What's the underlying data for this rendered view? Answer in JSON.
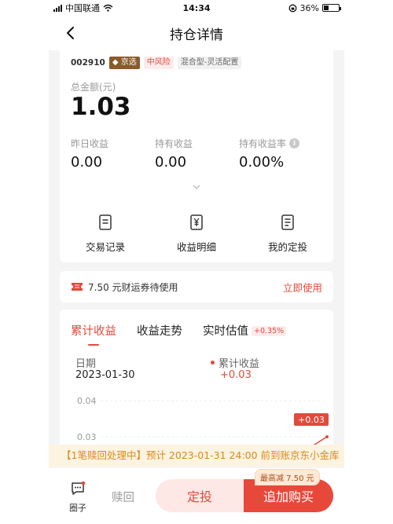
{
  "status_bar": {
    "carrier": "中国联通",
    "time": "14:34",
    "battery": "36%",
    "battery_level": 0.36
  },
  "nav": {
    "title": "持仓详情"
  },
  "fund": {
    "code": "002910",
    "tag_jx": "京选",
    "risk": "中风险",
    "type": "混合型-灵活配置"
  },
  "holding": {
    "total_label": "总金额(元)",
    "total_value": "1.03",
    "stats": [
      {
        "label": "昨日收益",
        "value": "0.00"
      },
      {
        "label": "持有收益",
        "value": "0.00"
      },
      {
        "label": "持有收益率",
        "value": "0.00%"
      }
    ]
  },
  "actions": [
    {
      "label": "交易记录",
      "icon": "record-icon"
    },
    {
      "label": "收益明细",
      "icon": "yen-receipt-icon"
    },
    {
      "label": "我的定投",
      "icon": "document-icon"
    }
  ],
  "coupon": {
    "text": "7.50 元财运券待使用",
    "link": "立即使用"
  },
  "chart_tabs": [
    {
      "label": "累计收益",
      "active": true
    },
    {
      "label": "收益走势",
      "active": false
    },
    {
      "label": "实时估值",
      "active": false,
      "badge": "+0.35%"
    }
  ],
  "chart_info": {
    "date_label": "日期",
    "date_value": "2023-01-30",
    "earn_label": "累计收益",
    "earn_value": "+0.03"
  },
  "chart_data": {
    "type": "line",
    "title": "",
    "xlabel": "",
    "ylabel": "",
    "y_ticks": [
      "0.04",
      "0.03"
    ],
    "ylim": [
      0.02,
      0.04
    ],
    "point_label": "+0.03",
    "series": [
      {
        "values": [
          0.027,
          0.03
        ]
      }
    ]
  },
  "notice": "【1笔赎回处理中】预计 2023-01-31 24:00 前到账京东小金库",
  "bottom_bar": {
    "circle_label": "圈子",
    "redeem_label": "赎回",
    "fixed_label": "定投",
    "buy_label": "追加购买",
    "buy_badge": "最高减 7.50 元"
  },
  "colors": {
    "accent": "#e24a3c",
    "notice": "#d98a1c"
  }
}
